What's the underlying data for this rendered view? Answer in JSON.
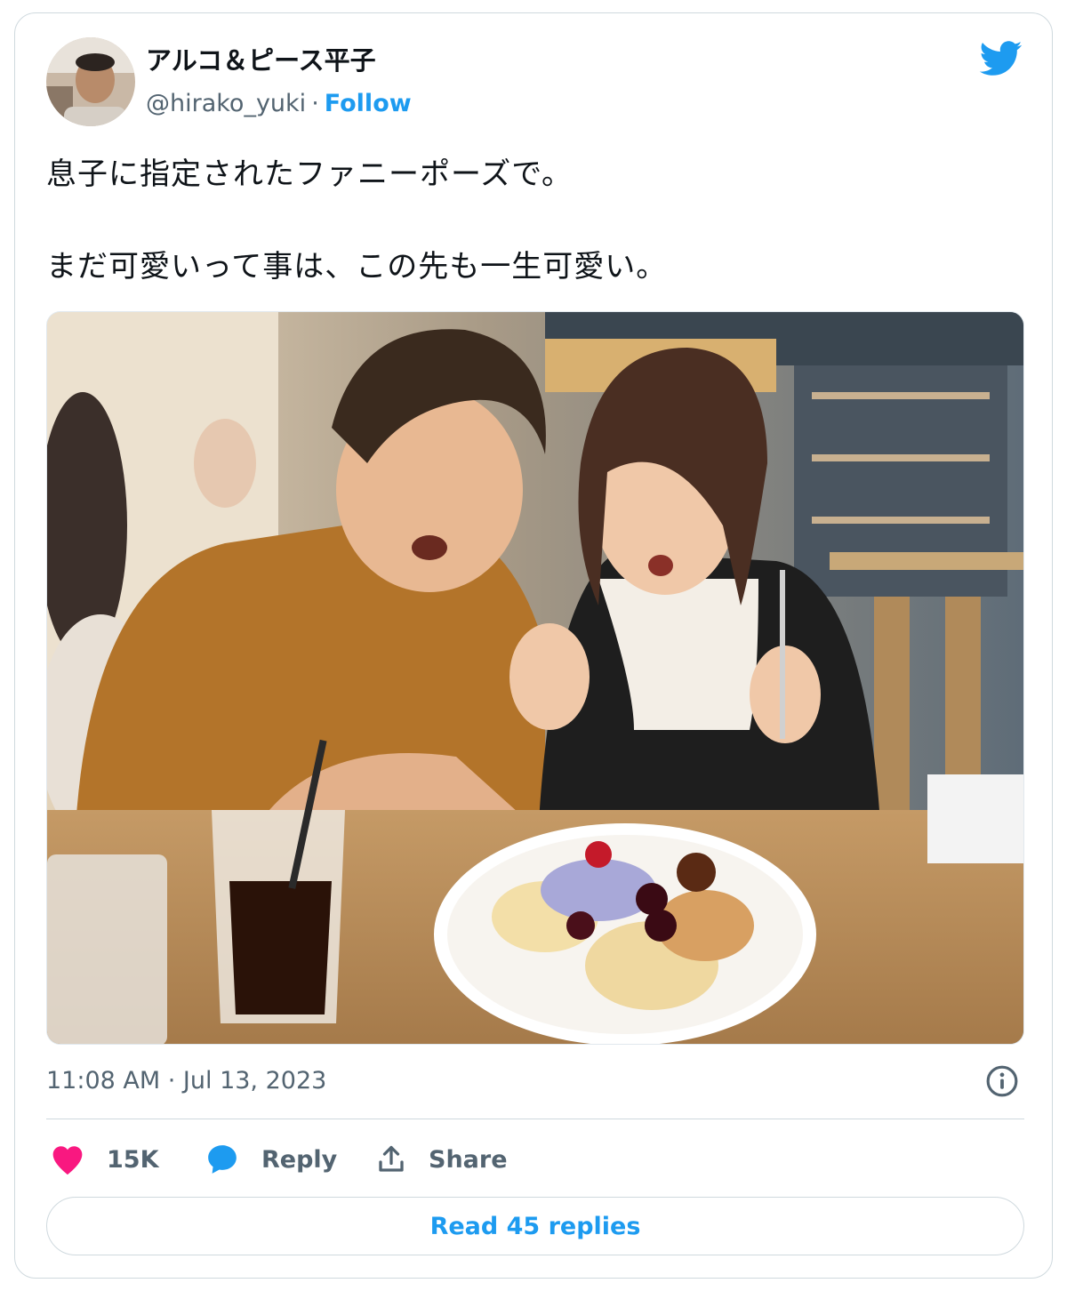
{
  "author": {
    "display_name": "アルコ＆ピース平子",
    "handle": "@hirako_yuki",
    "separator": "·",
    "follow_label": "Follow"
  },
  "tweet": {
    "lines": [
      "息子に指定されたファニーポーズで。",
      "まだ可愛いって事は、この先も一生可愛い。"
    ],
    "timestamp": "11:08 AM · Jul 13, 2023"
  },
  "actions": {
    "like_count": "15K",
    "reply_label": "Reply",
    "share_label": "Share"
  },
  "read_replies_label": "Read 45 replies",
  "colors": {
    "accent": "#1d9bf0",
    "like": "#f91880",
    "text_primary": "#0f1419",
    "text_secondary": "#536471",
    "border": "#cfd9de"
  },
  "icons": [
    "twitter-bird-icon",
    "info-icon",
    "heart-icon",
    "speech-bubble-icon",
    "share-upload-icon"
  ]
}
